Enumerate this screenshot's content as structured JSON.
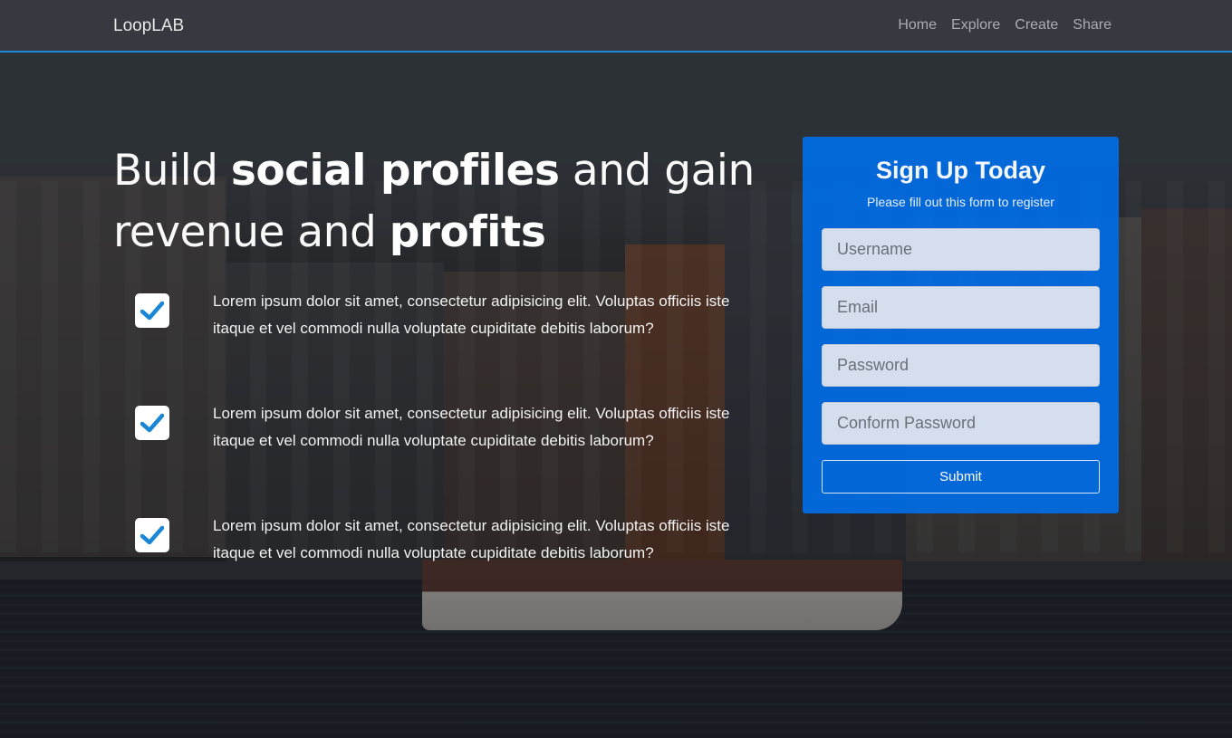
{
  "brand": "LoopLAB",
  "nav": {
    "items": [
      "Home",
      "Explore",
      "Create",
      "Share"
    ]
  },
  "hero": {
    "headline_parts": [
      "Build ",
      "social profiles",
      " and gain revenue and ",
      "profits"
    ]
  },
  "features": [
    {
      "text": "Lorem ipsum dolor sit amet, consectetur adipisicing elit. Voluptas officiis iste itaque et vel commodi nulla voluptate cupiditate debitis laborum?",
      "icon": "checkmark-icon"
    },
    {
      "text": "Lorem ipsum dolor sit amet, consectetur adipisicing elit. Voluptas officiis iste itaque et vel commodi nulla voluptate cupiditate debitis laborum?",
      "icon": "checkmark-icon"
    },
    {
      "text": "Lorem ipsum dolor sit amet, consectetur adipisicing elit. Voluptas officiis iste itaque et vel commodi nulla voluptate cupiditate debitis laborum?",
      "icon": "checkmark-icon"
    }
  ],
  "signup": {
    "title": "Sign Up Today",
    "subtitle": "Please fill out this form to register",
    "username_placeholder": "Username",
    "email_placeholder": "Email",
    "password_placeholder": "Password",
    "confirm_placeholder": "Conform Password",
    "submit_label": "Submit"
  },
  "colors": {
    "accent": "#1e88d8",
    "card": "#006ce6",
    "check": "#1a86d6"
  }
}
